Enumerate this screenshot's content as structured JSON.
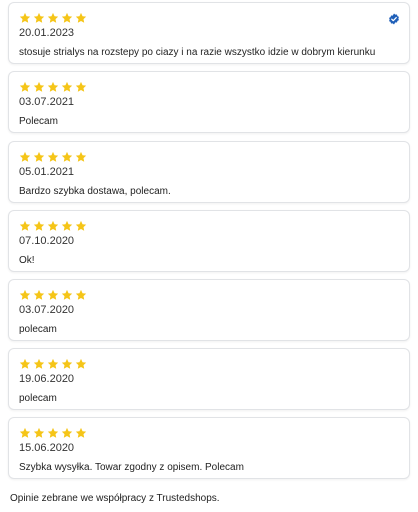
{
  "reviews": [
    {
      "rating": 5,
      "date": "20.01.2023",
      "text": "stosuje strialys na rozstepy po ciazy i na razie wszystko idzie w dobrym kierunku",
      "verified": true
    },
    {
      "rating": 5,
      "date": "03.07.2021",
      "text": "Polecam",
      "verified": false
    },
    {
      "rating": 5,
      "date": "05.01.2021",
      "text": "Bardzo szybka dostawa, polecam.",
      "verified": false
    },
    {
      "rating": 5,
      "date": "07.10.2020",
      "text": "Ok!",
      "verified": false
    },
    {
      "rating": 5,
      "date": "03.07.2020",
      "text": "polecam",
      "verified": false
    },
    {
      "rating": 5,
      "date": "19.06.2020",
      "text": "polecam",
      "verified": false
    },
    {
      "rating": 5,
      "date": "15.06.2020",
      "text": "Szybka wysyłka. Towar zgodny z opisem. Polecam",
      "verified": false
    }
  ],
  "footer": {
    "text": "Opinie zebrane we współpracy z Trustedshops."
  },
  "colors": {
    "star": "#f5c518",
    "verified_badge": "#1f5fb8",
    "card_border": "#e1e3e6"
  },
  "icons": {
    "star": "star-icon",
    "verified": "verified-badge-icon"
  }
}
